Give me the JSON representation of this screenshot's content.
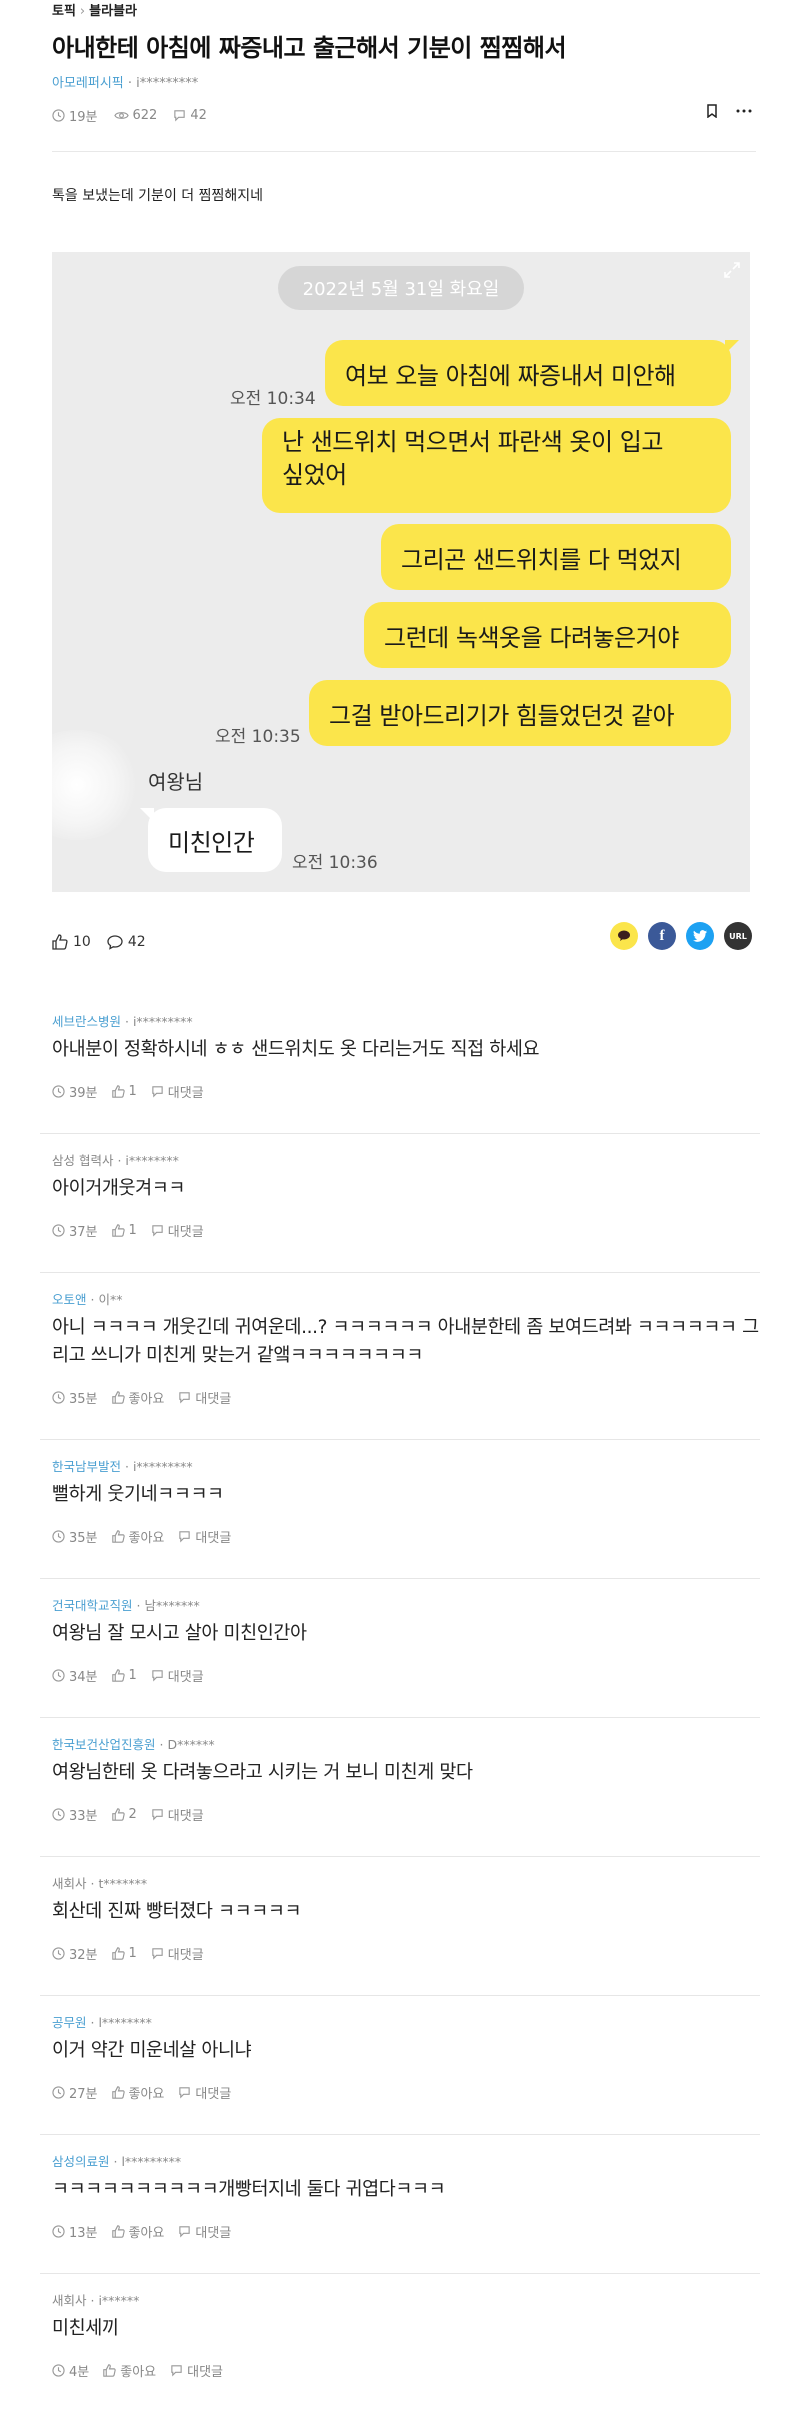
{
  "breadcrumb": {
    "topic": "토픽",
    "board": "블라블라"
  },
  "post": {
    "title": "아내한테 아침에 짜증내고 출근해서 기분이 찜찜해서",
    "company": "아모레퍼시픽",
    "author": "i*********",
    "time": "19분",
    "views": "622",
    "comments": "42",
    "body": "톡을 보냈는데 기분이 더 찜찜해지네"
  },
  "chat": {
    "date": "2022년 5월 31일 화요일",
    "messages": [
      {
        "text": "여보 오늘 아침에 짜증내서 미안해"
      },
      {
        "text": "난 샌드위치 먹으면서 파란색 옷이 입고\n싶었어"
      },
      {
        "text": "그리곤 샌드위치를 다 먹었지"
      },
      {
        "text": "그런데 녹색옷을 다려놓은거야"
      },
      {
        "text": "그걸 받아드리기가 힘들었던것 같아"
      }
    ],
    "time1": "오전 10:34",
    "time2": "오전 10:35",
    "sender": "여왕님",
    "reply": "미친인간",
    "time3": "오전 10:36"
  },
  "actions": {
    "likes": "10",
    "comments": "42",
    "url_label": "URL"
  },
  "colors": {
    "kakao": "#fbe54b",
    "facebook": "#3b5998",
    "twitter": "#1da1f2",
    "url": "#333333",
    "company": "#4a9fd1"
  },
  "comment_labels": {
    "reply": "대댓글",
    "like": "좋아요"
  },
  "comments": [
    {
      "company": "세브란스병원",
      "author": "i*********",
      "text": "아내분이 정확하시네 ㅎㅎ 샌드위치도 옷 다리는거도 직접 하세요",
      "time": "39분",
      "likes": "1"
    },
    {
      "company": "삼성 협력사",
      "author": "i********",
      "text": "아이거개웃겨ㅋㅋ",
      "time": "37분",
      "likes": "1"
    },
    {
      "company": "오토앤",
      "author": "이**",
      "text": "아니 ㅋㅋㅋㅋ 개웃긴데 귀여운데...? ㅋㅋㅋㅋㅋㅋ 아내분한테 좀 보여드려봐 ㅋㅋㅋㅋㅋㅋ 그리고 쓰니가 미친게 맞는거 같앸ㅋㅋㅋㅋㅋㅋㅋㅋ",
      "time": "35분",
      "likes": "좋아요"
    },
    {
      "company": "한국남부발전",
      "author": "i*********",
      "text": "뻘하게 웃기네ㅋㅋㅋㅋ",
      "time": "35분",
      "likes": "좋아요"
    },
    {
      "company": "건국대학교직원",
      "author": "남*******",
      "text": "여왕님 잘 모시고 살아 미친인간아",
      "time": "34분",
      "likes": "1"
    },
    {
      "company": "한국보건산업진흥원",
      "author": "D******",
      "text": "여왕님한테 옷 다려놓으라고 시키는 거 보니 미친게 맞다",
      "time": "33분",
      "likes": "2"
    },
    {
      "company": "새회사",
      "author": "t*******",
      "text": "회산데 진짜 빵터졌다 ㅋㅋㅋㅋㅋ",
      "time": "32분",
      "likes": "1"
    },
    {
      "company": "공무원",
      "author": "l********",
      "text": "이거 약간 미운네살 아니냐",
      "time": "27분",
      "likes": "좋아요"
    },
    {
      "company": "삼성의료원",
      "author": "l*********",
      "text": "ㅋㅋㅋㅋㅋㅋㅋㅋㅋㅋ개빵터지네 둘다 귀엽다ㅋㅋㅋ",
      "time": "13분",
      "likes": "좋아요"
    },
    {
      "company": "새회사",
      "author": "i******",
      "text": "미친세끼",
      "time": "4분",
      "likes": "좋아요"
    }
  ]
}
